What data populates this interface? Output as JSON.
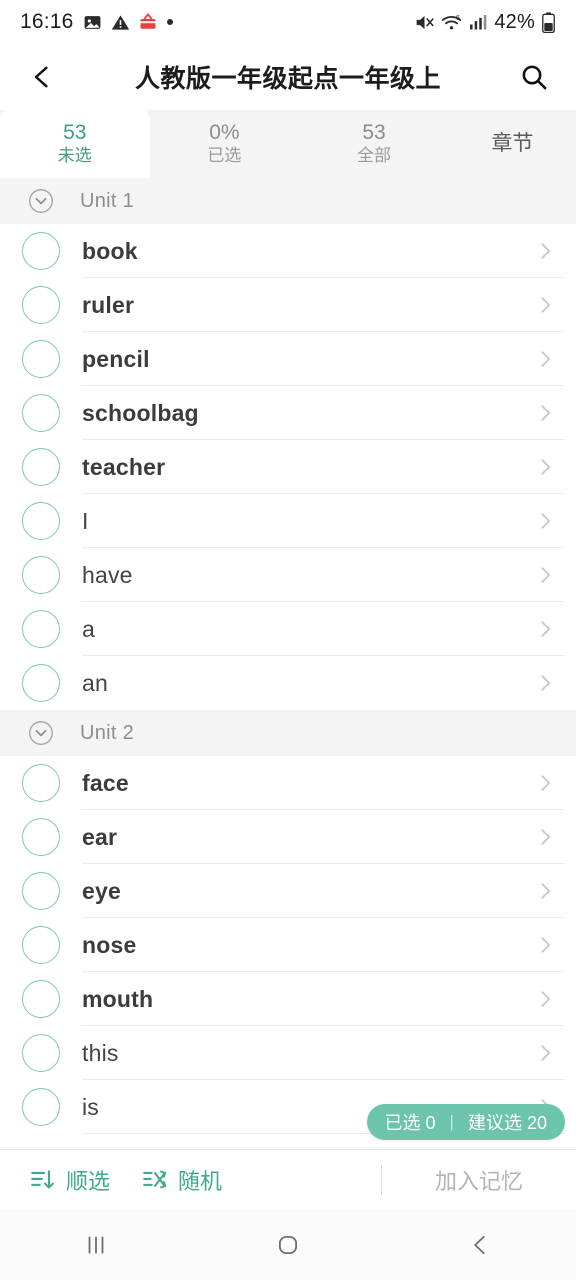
{
  "statusbar": {
    "time": "16:16",
    "battery_percent": "42%",
    "icons": [
      "image-icon",
      "warning-icon",
      "app-icon",
      "dot-icon",
      "mute-icon",
      "wifi-icon",
      "signal-icon",
      "battery-icon"
    ]
  },
  "header": {
    "title": "人教版一年级起点一年级上",
    "back_icon": "chevron-left-icon",
    "search_icon": "search-icon"
  },
  "tabs": [
    {
      "num": "53",
      "label": "未选",
      "active": true
    },
    {
      "num": "0%",
      "label": "已选",
      "active": false
    },
    {
      "num": "53",
      "label": "全部",
      "active": false
    },
    {
      "num": "",
      "label": "章节",
      "active": false
    }
  ],
  "units": [
    {
      "name": "Unit 1",
      "words": [
        {
          "text": "book",
          "bold": true
        },
        {
          "text": "ruler",
          "bold": true
        },
        {
          "text": "pencil",
          "bold": true
        },
        {
          "text": "schoolbag",
          "bold": true
        },
        {
          "text": "teacher",
          "bold": true
        },
        {
          "text": "I",
          "bold": false
        },
        {
          "text": "have",
          "bold": false
        },
        {
          "text": "a",
          "bold": false
        },
        {
          "text": "an",
          "bold": false
        }
      ]
    },
    {
      "name": "Unit 2",
      "words": [
        {
          "text": "face",
          "bold": true
        },
        {
          "text": "ear",
          "bold": true
        },
        {
          "text": "eye",
          "bold": true
        },
        {
          "text": "nose",
          "bold": true
        },
        {
          "text": "mouth",
          "bold": true
        },
        {
          "text": "this",
          "bold": false
        },
        {
          "text": "is",
          "bold": false
        }
      ]
    }
  ],
  "pill": {
    "selected_label": "已选 0",
    "separator": "|",
    "suggest_label": "建议选 20"
  },
  "toolbar": {
    "sort_label": "顺选",
    "random_label": "随机",
    "add_label": "加入记忆",
    "sort_icon": "sort-descending-icon",
    "random_icon": "shuffle-icon"
  },
  "navbar": {
    "recents_icon": "recents-icon",
    "home_icon": "home-icon",
    "back_icon": "back-icon"
  },
  "colors": {
    "accent": "#3fa98c",
    "pill_bg": "#6cc5ab",
    "checkbox_border": "#7fc7b2",
    "tabbar_bg": "#f4f4f4"
  }
}
